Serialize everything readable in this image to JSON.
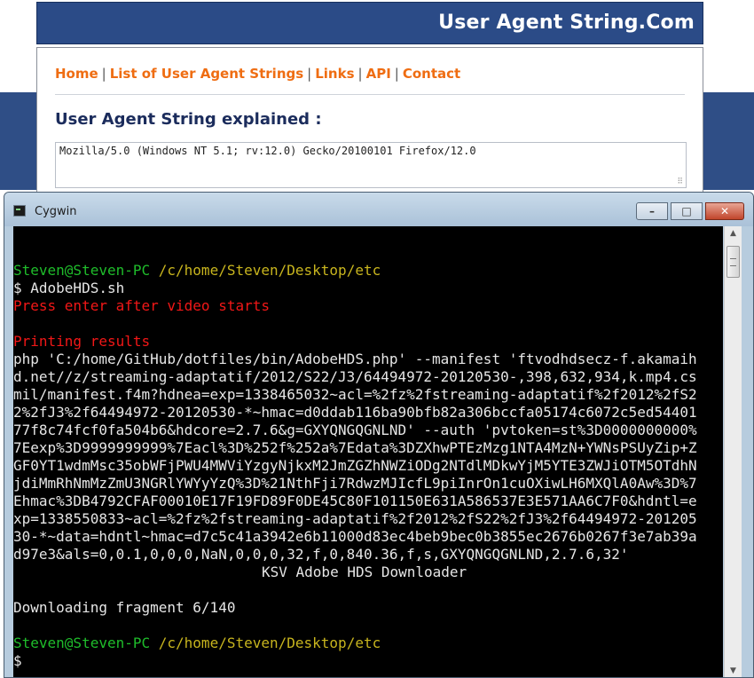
{
  "site": {
    "title": "User Agent String.Com",
    "nav": [
      "Home",
      "List of User Agent Strings",
      "Links",
      "API",
      "Contact"
    ],
    "heading": "User Agent String explained :",
    "ua_value": "Mozilla/5.0 (Windows NT 5.1; rv:12.0) Gecko/20100101 Firefox/12.0"
  },
  "window": {
    "title": "Cygwin",
    "buttons": {
      "minimize": "–",
      "maximize": "□",
      "close": "✕"
    }
  },
  "terminal": {
    "prompt_user": "Steven@Steven-PC",
    "prompt_path": "/c/home/Steven/Desktop/etc",
    "command": "$ AdobeHDS.sh",
    "press_enter": "Press enter after video starts",
    "printing": "Printing results",
    "output": [
      "php 'C:/home/GitHub/dotfiles/bin/AdobeHDS.php' --manifest 'ftvodhdsecz-f.akamaih",
      "d.net//z/streaming-adaptatif/2012/S22/J3/64494972-20120530-,398,632,934,k.mp4.cs",
      "mil/manifest.f4m?hdnea=exp=1338465032~acl=%2fz%2fstreaming-adaptatif%2f2012%2fS2",
      "2%2fJ3%2f64494972-20120530-*~hmac=d0ddab116ba90bfb82a306bccfa05174c6072c5ed54401",
      "77f8c74fcf0fa504b6&hdcore=2.7.6&g=GXYQNGQGNLND' --auth 'pvtoken=st%3D0000000000%",
      "7Eexp%3D9999999999%7Eacl%3D%252f%252a%7Edata%3DZXhwPTEzMzg1NTA4MzN+YWNsPSUyZip+Z",
      "GF0YT1wdmMsc35obWFjPWU4MWViYzgyNjkxM2JmZGZhNWZiODg2NTdlMDkwYjM5YTE3ZWJiOTM5OTdhN",
      "jdiMmRhNmMzZmU3NGRlYWYyYzQ%3D%21NthFji7RdwzMJIcfL9piInrOn1cuOXiwLH6MXQlA0Aw%3D%7",
      "Ehmac%3DB4792CFAF00010E17F19FD89F0DE45C80F101150E631A586537E3E571AA6C7F0&hdntl=e",
      "xp=1338550833~acl=%2fz%2fstreaming-adaptatif%2f2012%2fS22%2fJ3%2f64494972-201205",
      "30-*~data=hdntl~hmac=d7c5c41a3942e6b11000d83ec4beb9bec0b3855ec2676b0267f3e7ab39a",
      "d97e3&als=0,0.1,0,0,0,NaN,0,0,0,32,f,0,840.36,f,s,GXYQNGQGNLND,2.7.6,32'"
    ],
    "banner": "KSV Adobe HDS Downloader",
    "progress": "Downloading fragment 6/140",
    "final_prompt": "$"
  }
}
